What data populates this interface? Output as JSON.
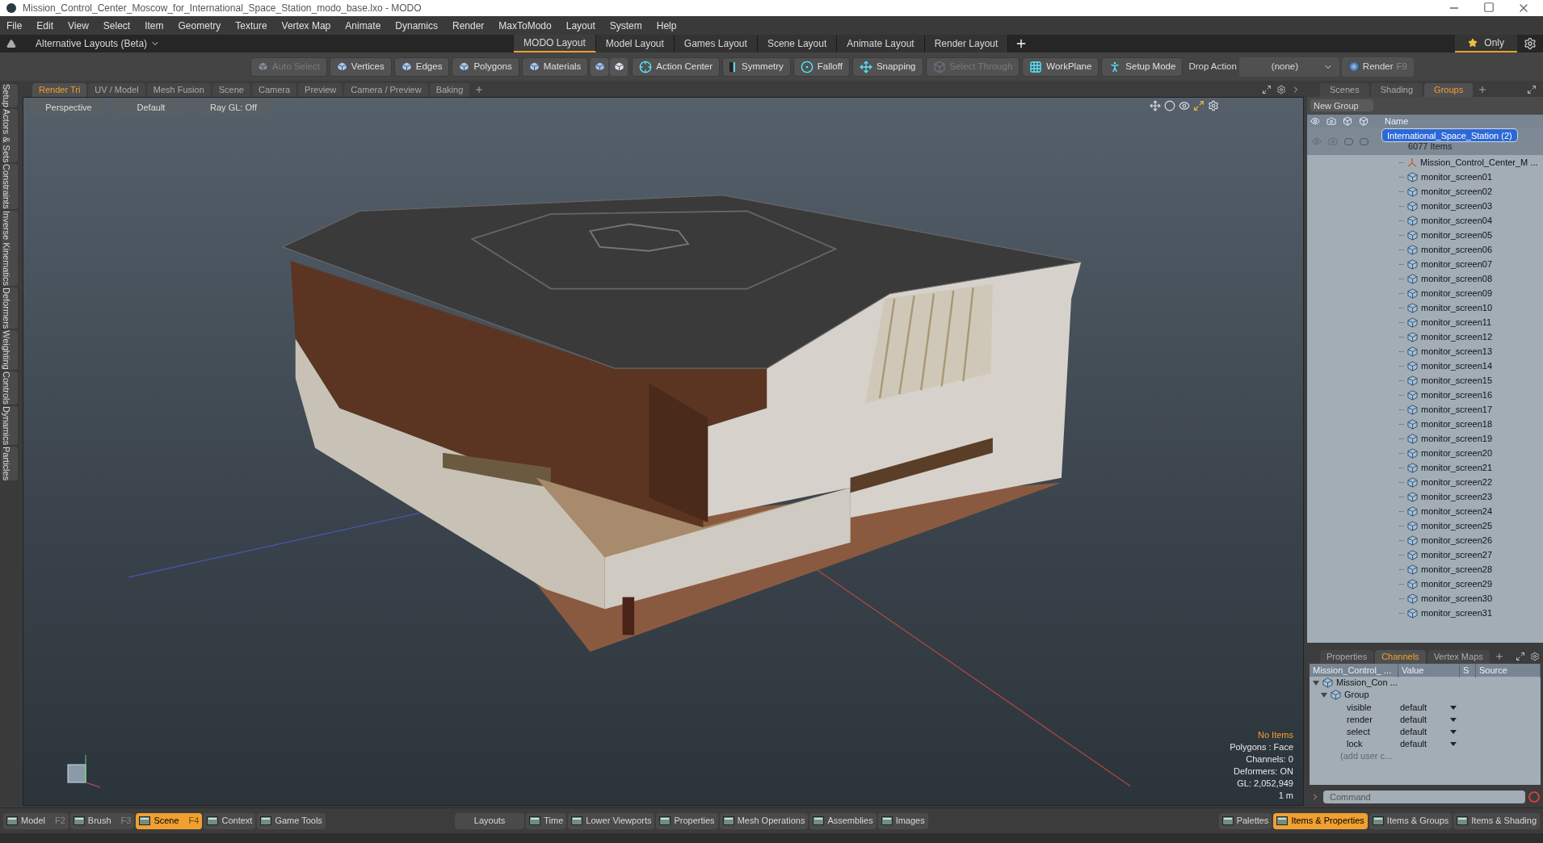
{
  "window": {
    "title": "Mission_Control_Center_Moscow_for_International_Space_Station_modo_base.lxo - MODO"
  },
  "menu": [
    "File",
    "Edit",
    "View",
    "Select",
    "Item",
    "Geometry",
    "Texture",
    "Vertex Map",
    "Animate",
    "Dynamics",
    "Render",
    "MaxToModo",
    "Layout",
    "System",
    "Help"
  ],
  "layout_bar": {
    "dropdown": "Alternative Layouts (Beta)",
    "only": "Only",
    "tabs": [
      {
        "label": "MODO Layout",
        "selected": true
      },
      {
        "label": "Model Layout",
        "selected": false
      },
      {
        "label": "Games Layout",
        "selected": false
      },
      {
        "label": "Scene Layout",
        "selected": false
      },
      {
        "label": "Animate Layout",
        "selected": false
      },
      {
        "label": "Render Layout",
        "selected": false
      }
    ]
  },
  "toolbar": [
    {
      "label": "Auto Select",
      "disabled": true
    },
    {
      "label": "Vertices",
      "disabled": false
    },
    {
      "label": "Edges",
      "disabled": false
    },
    {
      "label": "Polygons",
      "disabled": false
    },
    {
      "label": "Materials",
      "disabled": false
    },
    {
      "label": "Action Center",
      "disabled": false
    },
    {
      "label": "Symmetry",
      "disabled": false
    },
    {
      "label": "Falloff",
      "disabled": false
    },
    {
      "label": "Snapping",
      "disabled": false
    },
    {
      "label": "Select Through",
      "disabled": true
    },
    {
      "label": "WorkPlane",
      "disabled": false
    },
    {
      "label": "Setup Mode",
      "disabled": false
    }
  ],
  "drop_action": {
    "label": "Drop Action",
    "value": "(none)"
  },
  "render_button": {
    "label": "Render",
    "shortcut": "F9"
  },
  "side_tabs": [
    "Setup",
    "Actors & Sets",
    "Constraints",
    "Inverse Kinematics",
    "Deformers",
    "Weighting",
    "Controls",
    "Dynamics",
    "Particles"
  ],
  "viewport": {
    "tabs": [
      {
        "label": "Render Tri",
        "selected": true
      },
      {
        "label": "UV / Model",
        "selected": false
      },
      {
        "label": "Mesh Fusion",
        "selected": false
      },
      {
        "label": "Scene",
        "selected": false
      },
      {
        "label": "Camera",
        "selected": false
      },
      {
        "label": "Preview",
        "selected": false
      },
      {
        "label": "Camera / Preview",
        "selected": false
      },
      {
        "label": "Baking",
        "selected": false
      }
    ],
    "header": [
      "Perspective",
      "Default",
      "Ray GL: Off"
    ],
    "info": [
      {
        "text": "No Items",
        "highlight": true
      },
      {
        "text": "Polygons : Face",
        "highlight": false
      },
      {
        "text": "Channels: 0",
        "highlight": false
      },
      {
        "text": "Deformers: ON",
        "highlight": false
      },
      {
        "text": "GL: 2,052,949",
        "highlight": false
      },
      {
        "text": "1 m",
        "highlight": false
      }
    ]
  },
  "panel_tabs": [
    {
      "label": "Scenes",
      "selected": false
    },
    {
      "label": "Shading",
      "selected": false
    },
    {
      "label": "Groups",
      "selected": true
    }
  ],
  "new_group": "New Group",
  "name_column": "Name",
  "group": {
    "name": "International_Space_Station (2)",
    "count": "6077 Items",
    "selected": true
  },
  "items": [
    {
      "name": "Mission_Control_Center_M ...",
      "kind": "locator"
    },
    {
      "name": "monitor_screen01",
      "kind": "mesh"
    },
    {
      "name": "monitor_screen02",
      "kind": "mesh"
    },
    {
      "name": "monitor_screen03",
      "kind": "mesh"
    },
    {
      "name": "monitor_screen04",
      "kind": "mesh"
    },
    {
      "name": "monitor_screen05",
      "kind": "mesh"
    },
    {
      "name": "monitor_screen06",
      "kind": "mesh"
    },
    {
      "name": "monitor_screen07",
      "kind": "mesh"
    },
    {
      "name": "monitor_screen08",
      "kind": "mesh"
    },
    {
      "name": "monitor_screen09",
      "kind": "mesh"
    },
    {
      "name": "monitor_screen10",
      "kind": "mesh"
    },
    {
      "name": "monitor_screen11",
      "kind": "mesh"
    },
    {
      "name": "monitor_screen12",
      "kind": "mesh"
    },
    {
      "name": "monitor_screen13",
      "kind": "mesh"
    },
    {
      "name": "monitor_screen14",
      "kind": "mesh"
    },
    {
      "name": "monitor_screen15",
      "kind": "mesh"
    },
    {
      "name": "monitor_screen16",
      "kind": "mesh"
    },
    {
      "name": "monitor_screen17",
      "kind": "mesh"
    },
    {
      "name": "monitor_screen18",
      "kind": "mesh"
    },
    {
      "name": "monitor_screen19",
      "kind": "mesh"
    },
    {
      "name": "monitor_screen20",
      "kind": "mesh"
    },
    {
      "name": "monitor_screen21",
      "kind": "mesh"
    },
    {
      "name": "monitor_screen22",
      "kind": "mesh"
    },
    {
      "name": "monitor_screen23",
      "kind": "mesh"
    },
    {
      "name": "monitor_screen24",
      "kind": "mesh"
    },
    {
      "name": "monitor_screen25",
      "kind": "mesh"
    },
    {
      "name": "monitor_screen26",
      "kind": "mesh"
    },
    {
      "name": "monitor_screen27",
      "kind": "mesh"
    },
    {
      "name": "monitor_screen28",
      "kind": "mesh"
    },
    {
      "name": "monitor_screen29",
      "kind": "mesh"
    },
    {
      "name": "monitor_screen30",
      "kind": "mesh"
    },
    {
      "name": "monitor_screen31",
      "kind": "mesh"
    }
  ],
  "channels": {
    "tabs": [
      {
        "label": "Properties",
        "selected": false
      },
      {
        "label": "Channels",
        "selected": true
      },
      {
        "label": "Vertex Maps",
        "selected": false
      }
    ],
    "columns": [
      "Mission_Control_ ...",
      "Value",
      "S",
      "Source"
    ],
    "tree": {
      "name": "Mission_Con ...",
      "expanded": true,
      "children": [
        {
          "name": "Group",
          "expanded": true,
          "children": [
            {
              "name": "visible",
              "value": "default"
            },
            {
              "name": "render",
              "value": "default"
            },
            {
              "name": "select",
              "value": "default"
            },
            {
              "name": "lock",
              "value": "default"
            }
          ]
        }
      ]
    },
    "add_user": "(add user c..."
  },
  "command": {
    "placeholder": "Command"
  },
  "bottom_bar": {
    "left": [
      {
        "label": "Model",
        "shortcut": "F2",
        "selected": false
      },
      {
        "label": "Brush",
        "shortcut": "F3",
        "selected": false
      },
      {
        "label": "Scene",
        "shortcut": "F4",
        "selected": true
      },
      {
        "label": "Context",
        "selected": false
      },
      {
        "label": "Game Tools",
        "selected": false
      }
    ],
    "center": [
      {
        "label": "Layouts",
        "kind": "plain"
      },
      {
        "label": "Time",
        "kind": "icon"
      },
      {
        "label": "Lower Viewports",
        "kind": "icon"
      },
      {
        "label": "Properties",
        "kind": "icon"
      },
      {
        "label": "Mesh Operations",
        "kind": "icon"
      },
      {
        "label": "Assemblies",
        "kind": "icon"
      },
      {
        "label": "Images",
        "kind": "icon"
      }
    ],
    "right": [
      {
        "label": "Palettes",
        "selected": false
      },
      {
        "label": "Items & Properties",
        "selected": true
      },
      {
        "label": "Items & Groups",
        "selected": false
      },
      {
        "label": "Items & Shading",
        "selected": false
      }
    ]
  }
}
